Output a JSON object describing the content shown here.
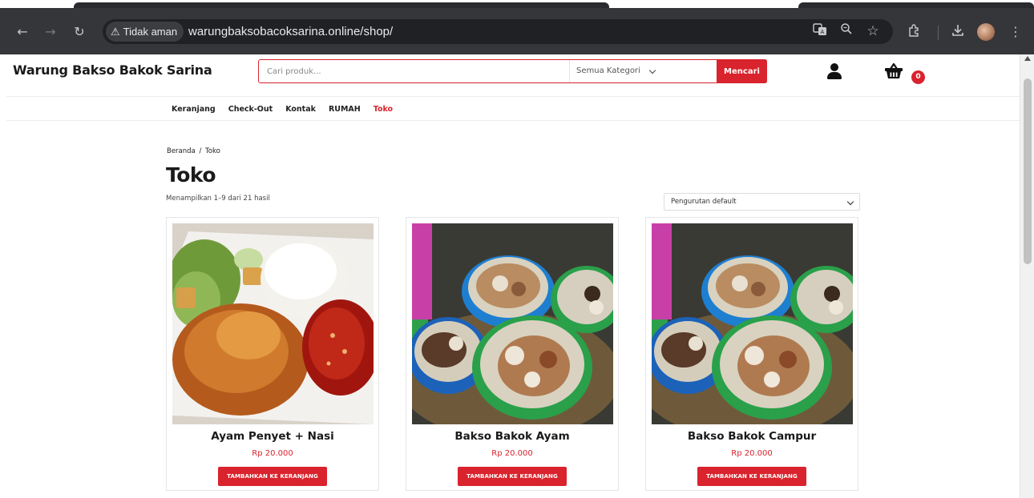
{
  "browser": {
    "security_label": "Tidak aman",
    "url": "warungbaksobacoksarina.online/shop/"
  },
  "site": {
    "brand": "Warung Bakso Bakok Sarina",
    "search": {
      "placeholder": "Cari produk...",
      "category": "Semua Kategori",
      "button": "Mencari"
    },
    "cart_count": "0",
    "nav": [
      "Keranjang",
      "Check-Out",
      "Kontak",
      "RUMAH",
      "Toko"
    ],
    "nav_active": "Toko"
  },
  "shop": {
    "breadcrumb": {
      "home": "Beranda",
      "separator": "/",
      "current": "Toko"
    },
    "title": "Toko",
    "result_count": "Menampilkan 1–9 dari 21 hasil",
    "sort": "Pengurutan default"
  },
  "products": [
    {
      "name": "Ayam Penyet + Nasi",
      "price": "Rp 20.000",
      "button": "TAMBAHKAN KE KERANJANG",
      "image": "fried-chicken-with-rice-and-sambal"
    },
    {
      "name": "Bakso Bakok Ayam",
      "price": "Rp 20.000",
      "button": "TAMBAHKAN KE KERANJANG",
      "image": "bowls-of-meatball-soup"
    },
    {
      "name": "Bakso Bakok Campur",
      "price": "Rp 20.000",
      "button": "TAMBAHKAN KE KERANJANG",
      "image": "bowls-of-meatball-soup"
    }
  ],
  "colors": {
    "accent": "#d9232d",
    "chrome": "#35363a"
  }
}
